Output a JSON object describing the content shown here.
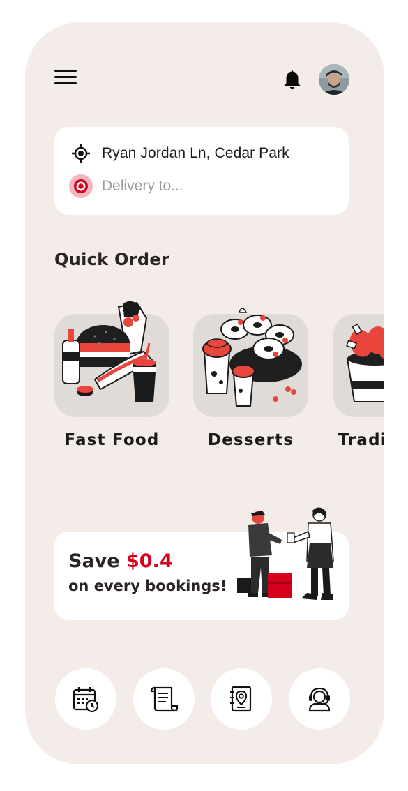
{
  "header": {
    "menu_icon": "hamburger-menu-icon",
    "notification_icon": "bell-icon",
    "avatar": "user-avatar"
  },
  "location": {
    "current_address": "Ryan Jordan Ln, Cedar Park",
    "current_icon": "crosshair-location-icon",
    "destination_placeholder": "Delivery to...",
    "destination_value": "",
    "destination_icon": "destination-pin-icon"
  },
  "quick_order": {
    "title": "Quick Order",
    "items": [
      {
        "label": "Fast Food",
        "icon": "fast-food-illustration"
      },
      {
        "label": "Desserts",
        "icon": "desserts-illustration"
      },
      {
        "label": "Traditional",
        "icon": "traditional-food-illustration"
      }
    ]
  },
  "promo": {
    "prefix": "Save ",
    "amount": "$0.4",
    "subtitle": "on every bookings!",
    "illustration": "delivery-handoff-illustration"
  },
  "bottom_actions": [
    {
      "icon": "calendar-clock-icon"
    },
    {
      "icon": "receipt-scroll-icon"
    },
    {
      "icon": "address-book-pin-icon"
    },
    {
      "icon": "support-agent-icon"
    }
  ],
  "colors": {
    "background": "#f4ece8",
    "card": "#ffffff",
    "tile": "#e1dbd8",
    "accent": "#d6001c",
    "text": "#2a2422"
  }
}
